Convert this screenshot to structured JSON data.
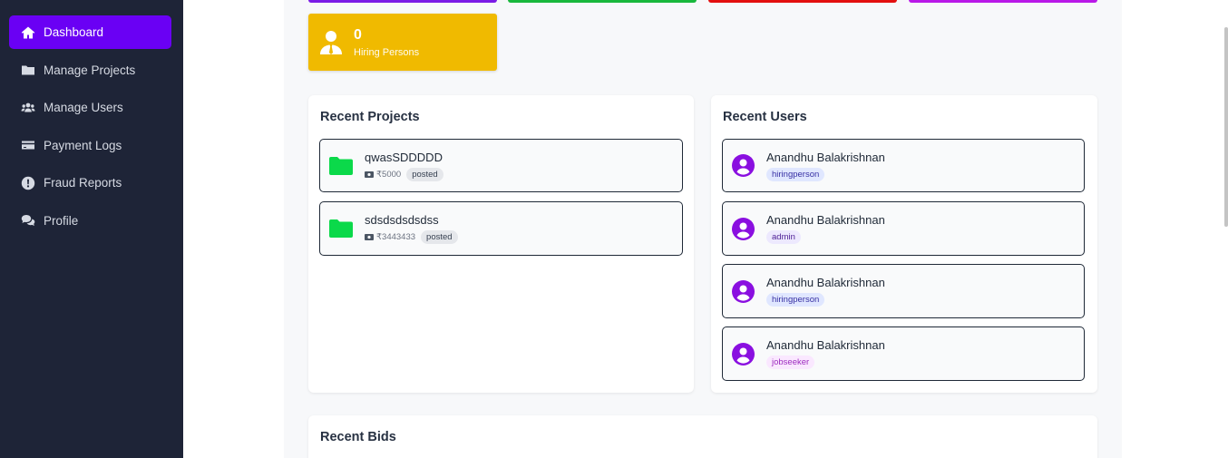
{
  "sidebar": {
    "items": [
      {
        "label": "Dashboard",
        "icon": "home-icon",
        "active": true
      },
      {
        "label": "Manage Projects",
        "icon": "folder-icon"
      },
      {
        "label": "Manage Users",
        "icon": "users-icon"
      },
      {
        "label": "Payment Logs",
        "icon": "credit-card-icon"
      },
      {
        "label": "Fraud Reports",
        "icon": "alert-circle-icon"
      },
      {
        "label": "Profile",
        "icon": "chat-icon"
      }
    ]
  },
  "colors": {
    "sidebar_bg": "#1e2437",
    "accent": "#6a00f4",
    "strip_purple": "#7a1be6",
    "strip_green": "#18b83c",
    "strip_red": "#e30f0f",
    "strip_magenta": "#b918e8",
    "hiring_card": "#f0ba00",
    "folder_green": "#0bd94a",
    "user_purple": "#8a0fe0"
  },
  "stat_card": {
    "value": "0",
    "label": "Hiring Persons",
    "icon": "person-tie-icon"
  },
  "recent_projects": {
    "title": "Recent Projects",
    "items": [
      {
        "name": "qwasSDDDDD",
        "amount": "₹5000",
        "status": "posted"
      },
      {
        "name": "sdsdsdsdsdss",
        "amount": "₹3443433",
        "status": "posted"
      }
    ]
  },
  "recent_users": {
    "title": "Recent Users",
    "items": [
      {
        "name": "Anandhu Balakrishnan",
        "role": "hiringperson"
      },
      {
        "name": "Anandhu Balakrishnan",
        "role": "admin"
      },
      {
        "name": "Anandhu Balakrishnan",
        "role": "hiringperson"
      },
      {
        "name": "Anandhu Balakrishnan",
        "role": "jobseeker"
      }
    ]
  },
  "recent_bids": {
    "title": "Recent Bids"
  }
}
